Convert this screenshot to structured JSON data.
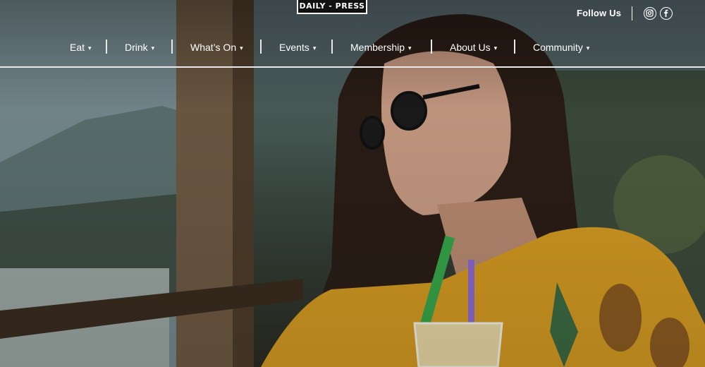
{
  "brand": {
    "logo_text": "DAILY - PRESS"
  },
  "header": {
    "follow_label": "Follow Us",
    "social": [
      {
        "icon": "instagram-icon"
      },
      {
        "icon": "facebook-icon"
      }
    ]
  },
  "nav": {
    "items": [
      {
        "label": "Eat"
      },
      {
        "label": "Drink"
      },
      {
        "label": "What’s On"
      },
      {
        "label": "Events"
      },
      {
        "label": "Membership"
      },
      {
        "label": "About Us"
      },
      {
        "label": "Community"
      }
    ],
    "caret": "▾"
  },
  "colors": {
    "nav_text": "#ffffff",
    "rule": "#e9e9e9",
    "logo_bg": "#111111"
  }
}
